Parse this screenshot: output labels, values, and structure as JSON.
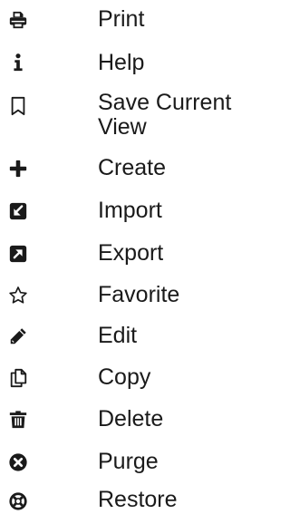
{
  "menu": {
    "items": [
      {
        "label": "Print",
        "icon": "print-icon"
      },
      {
        "label": "Help",
        "icon": "info-icon"
      },
      {
        "label": "Save Current View",
        "icon": "bookmark-icon"
      },
      {
        "label": "Create",
        "icon": "plus-icon"
      },
      {
        "label": "Import",
        "icon": "import-arrow-icon"
      },
      {
        "label": "Export",
        "icon": "export-arrow-icon"
      },
      {
        "label": "Favorite",
        "icon": "star-icon"
      },
      {
        "label": "Edit",
        "icon": "pencil-icon"
      },
      {
        "label": "Copy",
        "icon": "copy-icon"
      },
      {
        "label": "Delete",
        "icon": "trash-icon"
      },
      {
        "label": "Purge",
        "icon": "times-circle-icon"
      },
      {
        "label": "Restore",
        "icon": "life-ring-icon"
      }
    ]
  },
  "colors": {
    "text": "#1a1a1a",
    "icon": "#1a1a1a",
    "background": "#ffffff"
  }
}
